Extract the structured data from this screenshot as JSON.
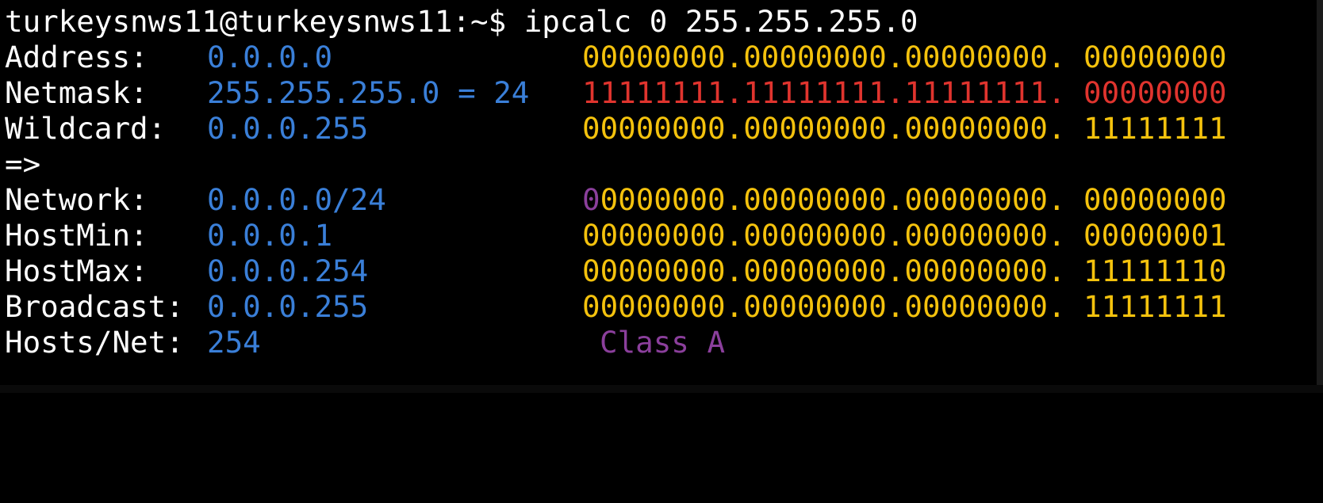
{
  "colors": {
    "text": "#ffffff",
    "value": "#3a7fd8",
    "binary": "#f4c20d",
    "netmask_bits": "#e0342e",
    "class_bit": "#8b3f9c",
    "background": "#000000"
  },
  "prompt": "turkeysnws11@turkeysnws11:~$ ipcalc 0 255.255.255.0",
  "rows": {
    "address": {
      "label": "Address:",
      "value": "0.0.0.0",
      "bin_prefix": "00000000.00000000.00000000.",
      "bin_host": "00000000"
    },
    "netmask": {
      "label": "Netmask:",
      "value": "255.255.255.0 = 24",
      "bin_prefix": "11111111.11111111.11111111.",
      "bin_host": "00000000"
    },
    "wildcard": {
      "label": "Wildcard:",
      "value": "0.0.0.255",
      "bin_prefix": "00000000.00000000.00000000.",
      "bin_host": "11111111"
    },
    "arrow": "=>",
    "network": {
      "label": "Network:",
      "value": "0.0.0.0/24",
      "bin_class_bit": "0",
      "bin_prefix": "0000000.00000000.00000000.",
      "bin_host": "00000000"
    },
    "hostmin": {
      "label": "HostMin:",
      "value": "0.0.0.1",
      "bin_prefix": "00000000.00000000.00000000.",
      "bin_host": "00000001"
    },
    "hostmax": {
      "label": "HostMax:",
      "value": "0.0.0.254",
      "bin_prefix": "00000000.00000000.00000000.",
      "bin_host": "11111110"
    },
    "broadcast": {
      "label": "Broadcast:",
      "value": "0.0.0.255",
      "bin_prefix": "00000000.00000000.00000000.",
      "bin_host": "11111111"
    },
    "hosts": {
      "label": "Hosts/Net:",
      "value": "254",
      "class_label": "Class A"
    }
  }
}
